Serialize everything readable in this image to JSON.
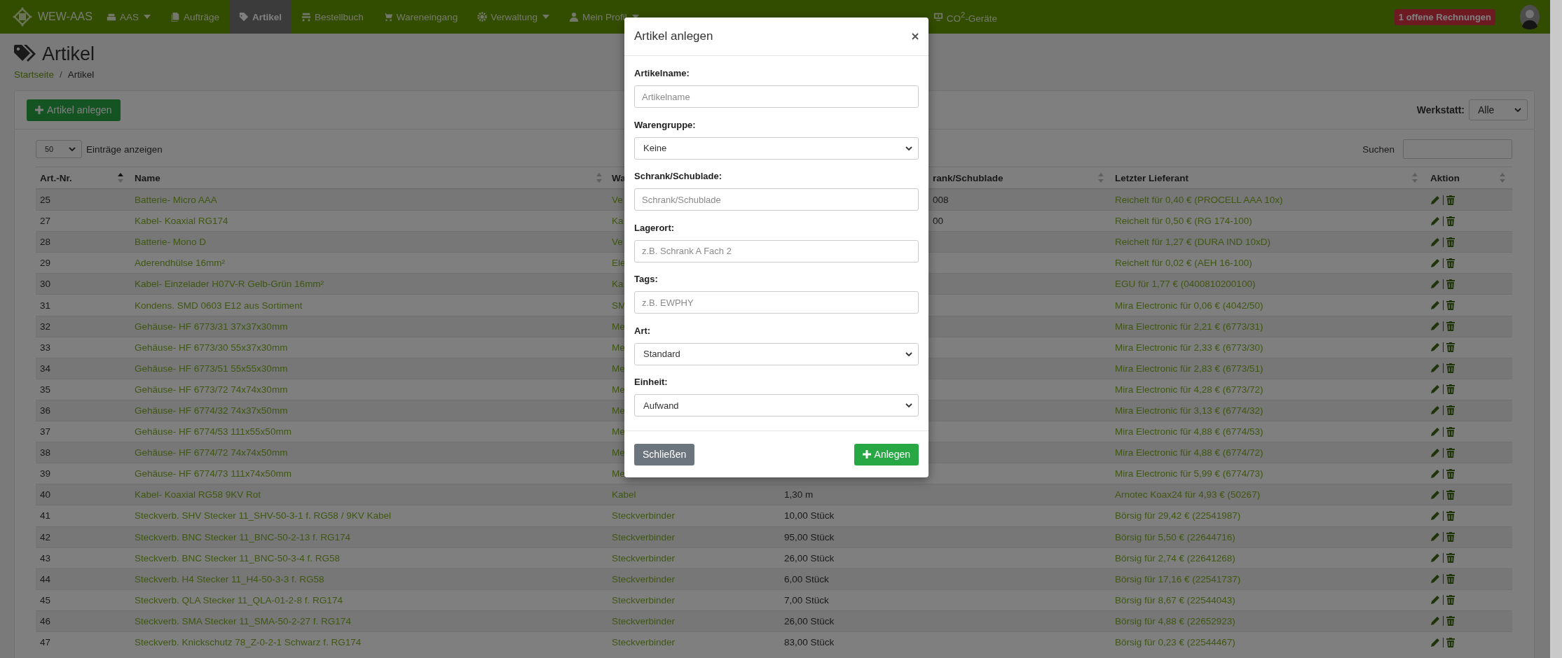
{
  "navbar": {
    "brand": "WEW-AAS",
    "items": [
      {
        "label": "AAS",
        "dropdown": true,
        "selected": false
      },
      {
        "label": "Aufträge",
        "dropdown": false,
        "selected": false
      },
      {
        "label": "Artikel",
        "dropdown": false,
        "selected": true
      },
      {
        "label": "Bestellbuch",
        "dropdown": false,
        "selected": false
      },
      {
        "label": "Wareneingang",
        "dropdown": false,
        "selected": false
      },
      {
        "label": "Verwaltung",
        "dropdown": true,
        "selected": false
      },
      {
        "label": "Mein Profil",
        "dropdown": true,
        "selected": false
      }
    ],
    "extra_items": [
      {
        "label": "CO$^{2}$-Geräte",
        "selected": false
      }
    ],
    "badge": "1 offene Rechnungen"
  },
  "page": {
    "title": "Artikel",
    "breadcrumb": [
      {
        "label": "Startseite",
        "kind": "link"
      },
      {
        "label": "Artikel",
        "kind": "current"
      }
    ],
    "breadcrumb_separator": "/"
  },
  "toolbar": {
    "add_button": "Artikel anlegen",
    "workshop_label": "Werkstatt:",
    "workshop_value": "Alle"
  },
  "table_controls": {
    "page_size": "50",
    "page_size_label": "Einträge anzeigen",
    "search_label": "Suchen"
  },
  "table": {
    "columns": [
      {
        "label": "Art.-Nr.",
        "sorted": true
      },
      {
        "label": "Name",
        "sorted": false
      },
      {
        "label": "Wa"
      },
      {
        "label": "rank/Schublade",
        "sorted": false
      },
      {
        "label": "Letzter Lieferant",
        "sorted": false
      },
      {
        "label": "Aktion",
        "sorted": false
      }
    ],
    "rows": [
      {
        "art_nr": "25",
        "name": "Batterie- Micro AAA",
        "group": "Ve",
        "location": "008",
        "supplier": "Reichelt für 0,40 € (PROCELL AAA 10x)"
      },
      {
        "art_nr": "27",
        "name": "Kabel- Koaxial RG174",
        "group": "Ka",
        "location": "00",
        "supplier": "Reichelt für 0,50 € (RG 174-100)"
      },
      {
        "art_nr": "28",
        "name": "Batterie- Mono D",
        "group": "Ve",
        "supplier": "Reichelt für 1,27 € (DURA IND 10xD)"
      },
      {
        "art_nr": "29",
        "name": "Aderendhülse 16mm²",
        "group": "Ele",
        "supplier": "Reichelt für 0,02 € (AEH 16-100)"
      },
      {
        "art_nr": "30",
        "name": "Kabel- Einzelader H07V-R Gelb-Grün 16mm²",
        "group": "Ka",
        "supplier": "EGU für 1,77 € (0400810200100)"
      },
      {
        "art_nr": "31",
        "name": "Kondens. SMD 0603 E12 aus Sortiment",
        "group": "SM",
        "supplier": "Mira Electronic für 0,06 € (4042/50)"
      },
      {
        "art_nr": "32",
        "name": "Gehäuse- HF 6773/31 37x37x30mm",
        "group": "Me",
        "supplier": "Mira Electronic für 2,21 € (6773/31)"
      },
      {
        "art_nr": "33",
        "name": "Gehäuse- HF 6773/30 55x37x30mm",
        "group": "Me",
        "supplier": "Mira Electronic für 2,33 € (6773/30)"
      },
      {
        "art_nr": "34",
        "name": "Gehäuse- HF 6773/51 55x55x30mm",
        "group": "Me",
        "supplier": "Mira Electronic für 2,83 € (6773/51)"
      },
      {
        "art_nr": "35",
        "name": "Gehäuse- HF 6773/72 74x74x30mm",
        "group": "Me",
        "supplier": "Mira Electronic für 4,28 € (6773/72)"
      },
      {
        "art_nr": "36",
        "name": "Gehäuse- HF 6774/32 74x37x50mm",
        "group": "Me",
        "supplier": "Mira Electronic für 3,13 € (6774/32)"
      },
      {
        "art_nr": "37",
        "name": "Gehäuse- HF 6774/53 111x55x50mm",
        "group": "Me",
        "supplier": "Mira Electronic für 4,88 € (6774/53)"
      },
      {
        "art_nr": "38",
        "name": "Gehäuse- HF 6774/72 74x74x50mm",
        "group": "Me",
        "supplier": "Mira Electronic für 4,88 € (6774/72)"
      },
      {
        "art_nr": "39",
        "name": "Gehäuse- HF 6774/73 111x74x50mm",
        "group": "Me",
        "supplier": "Mira Electronic für 5,99 € (6774/73)"
      },
      {
        "art_nr": "40",
        "name": "Kabel- Koaxial RG58 9KV Rot",
        "group": "Kabel",
        "quantity": "1,30 m",
        "supplier": "Arnotec Koax24 für 4,93 € (50267)"
      },
      {
        "art_nr": "41",
        "name": "Steckverb. SHV Stecker 11_SHV-50-3-1 f. RG58 / 9KV Kabel",
        "group": "Steckverbinder",
        "quantity": "10,00 Stück",
        "supplier": "Börsig für 29,42 € (22541987)"
      },
      {
        "art_nr": "42",
        "name": "Steckverb. BNC Stecker 11_BNC-50-2-13 f. RG174",
        "group": "Steckverbinder",
        "quantity": "95,00 Stück",
        "supplier": "Börsig für 5,50 € (22644716)"
      },
      {
        "art_nr": "43",
        "name": "Steckverb. BNC Stecker 11_BNC-50-3-4 f. RG58",
        "group": "Steckverbinder",
        "quantity": "26,00 Stück",
        "supplier": "Börsig für 2,74 € (22641268)"
      },
      {
        "art_nr": "44",
        "name": "Steckverb. H4 Stecker 11_H4-50-3-3 f. RG58",
        "group": "Steckverbinder",
        "quantity": "6,00 Stück",
        "supplier": "Börsig für 17,16 € (22541737)"
      },
      {
        "art_nr": "45",
        "name": "Steckverb. QLA Stecker 11_QLA-01-2-8 f. RG174",
        "group": "Steckverbinder",
        "quantity": "7,00 Stück",
        "supplier": "Börsig für 8,67 € (22544043)"
      },
      {
        "art_nr": "46",
        "name": "Steckverb. SMA Stecker 11_SMA-50-2-27 f. RG174",
        "group": "Steckverbinder",
        "quantity": "26,00 Stück",
        "supplier": "Börsig für 4,88 € (22652923)"
      },
      {
        "art_nr": "47",
        "name": "Steckverb. Knickschutz 78_Z-0-2-1 Schwarz f. RG174",
        "group": "Steckverbinder",
        "quantity": "83,00 Stück",
        "supplier": "Börsig für 0,23 € (22544467)"
      }
    ]
  },
  "modal": {
    "title": "Artikel anlegen",
    "fields": [
      {
        "label": "Artikelname:",
        "kind": "text",
        "placeholder": "Artikelname"
      },
      {
        "label": "Warengruppe:",
        "kind": "select",
        "value": "Keine"
      },
      {
        "label": "Schrank/Schublade:",
        "kind": "text",
        "placeholder": "Schrank/Schublade"
      },
      {
        "label": "Lagerort:",
        "kind": "text",
        "placeholder": "z.B. Schrank A Fach 2"
      },
      {
        "label": "Tags:",
        "kind": "text",
        "placeholder": "z.B. EWPHY"
      },
      {
        "label": "Art:",
        "kind": "select",
        "value": "Standard"
      },
      {
        "label": "Einheit:",
        "kind": "select",
        "value": "Aufwand"
      }
    ],
    "close_button": "Schließen",
    "submit_button": "Anlegen"
  }
}
